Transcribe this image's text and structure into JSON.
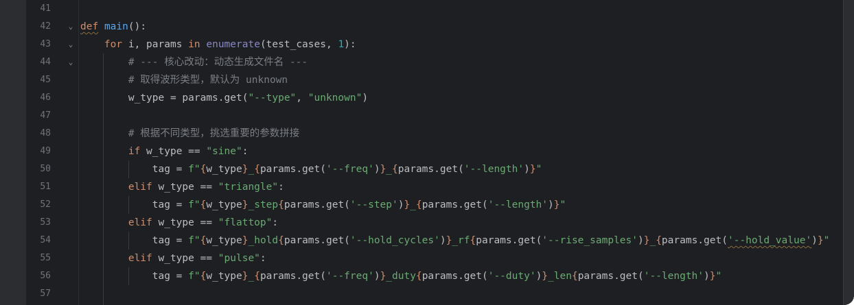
{
  "editor": {
    "lines": [
      {
        "n": "41",
        "fold": "",
        "tokens": []
      },
      {
        "n": "42",
        "fold": "⌄",
        "tokens": [
          {
            "t": "def",
            "c": "kw squig"
          },
          {
            "t": " ",
            "c": "id"
          },
          {
            "t": "main",
            "c": "fn"
          },
          {
            "t": "():",
            "c": "id"
          }
        ]
      },
      {
        "n": "43",
        "fold": "⌄",
        "tokens": [
          {
            "t": "    ",
            "c": "id"
          },
          {
            "t": "for",
            "c": "kw"
          },
          {
            "t": " i, params ",
            "c": "id"
          },
          {
            "t": "in",
            "c": "kw"
          },
          {
            "t": " ",
            "c": "id"
          },
          {
            "t": "enumerate",
            "c": "bi"
          },
          {
            "t": "(test_cases, ",
            "c": "id"
          },
          {
            "t": "1",
            "c": "num"
          },
          {
            "t": "):",
            "c": "id"
          }
        ]
      },
      {
        "n": "44",
        "fold": "⌄",
        "tokens": [
          {
            "t": "        ",
            "c": "id"
          },
          {
            "t": "# --- 核心改动：动态生成文件名 ---",
            "c": "cm"
          }
        ]
      },
      {
        "n": "45",
        "fold": "",
        "tokens": [
          {
            "t": "        ",
            "c": "id"
          },
          {
            "t": "# 取得波形类型，默认为 unknown",
            "c": "cm"
          }
        ]
      },
      {
        "n": "46",
        "fold": "",
        "tokens": [
          {
            "t": "        ",
            "c": "id"
          },
          {
            "t": "w_type = params.get(",
            "c": "id"
          },
          {
            "t": "\"--type\"",
            "c": "str"
          },
          {
            "t": ", ",
            "c": "id"
          },
          {
            "t": "\"unknown\"",
            "c": "str"
          },
          {
            "t": ")",
            "c": "id"
          }
        ]
      },
      {
        "n": "47",
        "fold": "",
        "tokens": []
      },
      {
        "n": "48",
        "fold": "",
        "tokens": [
          {
            "t": "        ",
            "c": "id"
          },
          {
            "t": "# 根据不同类型，挑选重要的参数拼接",
            "c": "cm"
          }
        ]
      },
      {
        "n": "49",
        "fold": "",
        "tokens": [
          {
            "t": "        ",
            "c": "id"
          },
          {
            "t": "if",
            "c": "kw"
          },
          {
            "t": " w_type == ",
            "c": "id"
          },
          {
            "t": "\"sine\"",
            "c": "str"
          },
          {
            "t": ":",
            "c": "id"
          }
        ]
      },
      {
        "n": "50",
        "fold": "",
        "tokens": [
          {
            "t": "            ",
            "c": "id"
          },
          {
            "t": "tag = ",
            "c": "id"
          },
          {
            "t": "f\"",
            "c": "str"
          },
          {
            "t": "{",
            "c": "br"
          },
          {
            "t": "w_type",
            "c": "id"
          },
          {
            "t": "}",
            "c": "br"
          },
          {
            "t": "_",
            "c": "str"
          },
          {
            "t": "{",
            "c": "br"
          },
          {
            "t": "params.get(",
            "c": "id"
          },
          {
            "t": "'--freq'",
            "c": "str"
          },
          {
            "t": ")",
            "c": "id"
          },
          {
            "t": "}",
            "c": "br"
          },
          {
            "t": "_",
            "c": "str"
          },
          {
            "t": "{",
            "c": "br"
          },
          {
            "t": "params.get(",
            "c": "id"
          },
          {
            "t": "'--length'",
            "c": "str"
          },
          {
            "t": ")",
            "c": "id"
          },
          {
            "t": "}",
            "c": "br"
          },
          {
            "t": "\"",
            "c": "str"
          }
        ]
      },
      {
        "n": "51",
        "fold": "",
        "tokens": [
          {
            "t": "        ",
            "c": "id"
          },
          {
            "t": "elif",
            "c": "kw"
          },
          {
            "t": " w_type == ",
            "c": "id"
          },
          {
            "t": "\"triangle\"",
            "c": "str"
          },
          {
            "t": ":",
            "c": "id"
          }
        ]
      },
      {
        "n": "52",
        "fold": "",
        "tokens": [
          {
            "t": "            ",
            "c": "id"
          },
          {
            "t": "tag = ",
            "c": "id"
          },
          {
            "t": "f\"",
            "c": "str"
          },
          {
            "t": "{",
            "c": "br"
          },
          {
            "t": "w_type",
            "c": "id"
          },
          {
            "t": "}",
            "c": "br"
          },
          {
            "t": "_step",
            "c": "str"
          },
          {
            "t": "{",
            "c": "br"
          },
          {
            "t": "params.get(",
            "c": "id"
          },
          {
            "t": "'--step'",
            "c": "str"
          },
          {
            "t": ")",
            "c": "id"
          },
          {
            "t": "}",
            "c": "br"
          },
          {
            "t": "_",
            "c": "str"
          },
          {
            "t": "{",
            "c": "br"
          },
          {
            "t": "params.get(",
            "c": "id"
          },
          {
            "t": "'--length'",
            "c": "str"
          },
          {
            "t": ")",
            "c": "id"
          },
          {
            "t": "}",
            "c": "br"
          },
          {
            "t": "\"",
            "c": "str"
          }
        ]
      },
      {
        "n": "53",
        "fold": "",
        "tokens": [
          {
            "t": "        ",
            "c": "id"
          },
          {
            "t": "elif",
            "c": "kw"
          },
          {
            "t": " w_type == ",
            "c": "id"
          },
          {
            "t": "\"flattop\"",
            "c": "str"
          },
          {
            "t": ":",
            "c": "id"
          }
        ]
      },
      {
        "n": "54",
        "fold": "",
        "tokens": [
          {
            "t": "            ",
            "c": "id"
          },
          {
            "t": "tag = ",
            "c": "id"
          },
          {
            "t": "f\"",
            "c": "str"
          },
          {
            "t": "{",
            "c": "br"
          },
          {
            "t": "w_type",
            "c": "id"
          },
          {
            "t": "}",
            "c": "br"
          },
          {
            "t": "_hold",
            "c": "str"
          },
          {
            "t": "{",
            "c": "br"
          },
          {
            "t": "params.get(",
            "c": "id"
          },
          {
            "t": "'--hold_cycles'",
            "c": "str"
          },
          {
            "t": ")",
            "c": "id"
          },
          {
            "t": "}",
            "c": "br"
          },
          {
            "t": "_rf",
            "c": "str"
          },
          {
            "t": "{",
            "c": "br"
          },
          {
            "t": "params.get(",
            "c": "id"
          },
          {
            "t": "'--rise_samples'",
            "c": "str"
          },
          {
            "t": ")",
            "c": "id"
          },
          {
            "t": "}",
            "c": "br"
          },
          {
            "t": "_",
            "c": "str"
          },
          {
            "t": "{",
            "c": "br"
          },
          {
            "t": "params.get(",
            "c": "id"
          },
          {
            "t": "'--hold_value'",
            "c": "str squig"
          },
          {
            "t": ")",
            "c": "id"
          },
          {
            "t": "}",
            "c": "br"
          },
          {
            "t": "\"",
            "c": "str"
          }
        ]
      },
      {
        "n": "55",
        "fold": "",
        "tokens": [
          {
            "t": "        ",
            "c": "id"
          },
          {
            "t": "elif",
            "c": "kw"
          },
          {
            "t": " w_type == ",
            "c": "id"
          },
          {
            "t": "\"pulse\"",
            "c": "str"
          },
          {
            "t": ":",
            "c": "id"
          }
        ]
      },
      {
        "n": "56",
        "fold": "",
        "tokens": [
          {
            "t": "            ",
            "c": "id"
          },
          {
            "t": "tag = ",
            "c": "id"
          },
          {
            "t": "f\"",
            "c": "str"
          },
          {
            "t": "{",
            "c": "br"
          },
          {
            "t": "w_type",
            "c": "id"
          },
          {
            "t": "}",
            "c": "br"
          },
          {
            "t": "_",
            "c": "str"
          },
          {
            "t": "{",
            "c": "br"
          },
          {
            "t": "params.get(",
            "c": "id"
          },
          {
            "t": "'--freq'",
            "c": "str"
          },
          {
            "t": ")",
            "c": "id"
          },
          {
            "t": "}",
            "c": "br"
          },
          {
            "t": "_duty",
            "c": "str"
          },
          {
            "t": "{",
            "c": "br"
          },
          {
            "t": "params.get(",
            "c": "id"
          },
          {
            "t": "'--duty'",
            "c": "str"
          },
          {
            "t": ")",
            "c": "id"
          },
          {
            "t": "}",
            "c": "br"
          },
          {
            "t": "_len",
            "c": "str"
          },
          {
            "t": "{",
            "c": "br"
          },
          {
            "t": "params.get(",
            "c": "id"
          },
          {
            "t": "'--length'",
            "c": "str"
          },
          {
            "t": ")",
            "c": "id"
          },
          {
            "t": "}",
            "c": "br"
          },
          {
            "t": "\"",
            "c": "str"
          }
        ]
      },
      {
        "n": "57",
        "fold": "",
        "tokens": []
      }
    ]
  }
}
